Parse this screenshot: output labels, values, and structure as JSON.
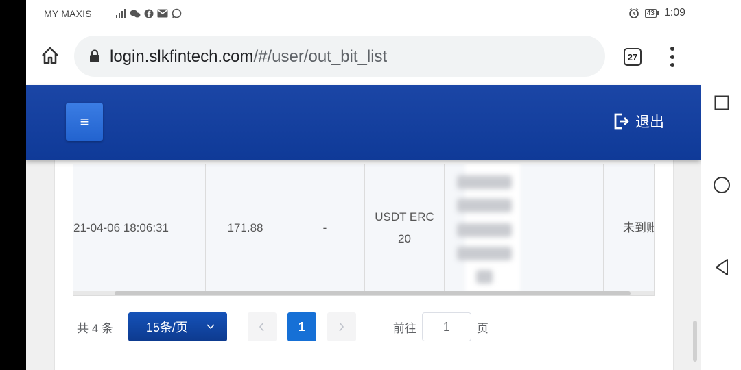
{
  "status_bar": {
    "carrier": "MY MAXIS",
    "time": "1:09",
    "battery": "43"
  },
  "browser": {
    "url_host": "login.slkfintech.com",
    "url_path": "/#/user/out_bit_list",
    "tab_count": "27"
  },
  "header": {
    "menu_glyph": "≡",
    "logout_label": "退出"
  },
  "table": {
    "row": {
      "time": "21-04-06 18:06:31",
      "amount": "171.88",
      "dash": "-",
      "coin_line1": "USDT ERC",
      "coin_line2": "20",
      "status": "未到账"
    }
  },
  "pagination": {
    "total": "共 4 条",
    "page_size": "15条/页",
    "current_page": "1",
    "goto_label": "前往",
    "goto_value": "1",
    "goto_suffix": "页"
  },
  "icons": {
    "home": "home-icon",
    "lock": "lock-icon",
    "logout": "logout-icon",
    "prev": "chevron-left-icon",
    "next": "chevron-right-icon",
    "dropdown": "chevron-down-icon"
  },
  "colors": {
    "header_blue": "#0f3a98",
    "active_page": "#1670d6"
  }
}
